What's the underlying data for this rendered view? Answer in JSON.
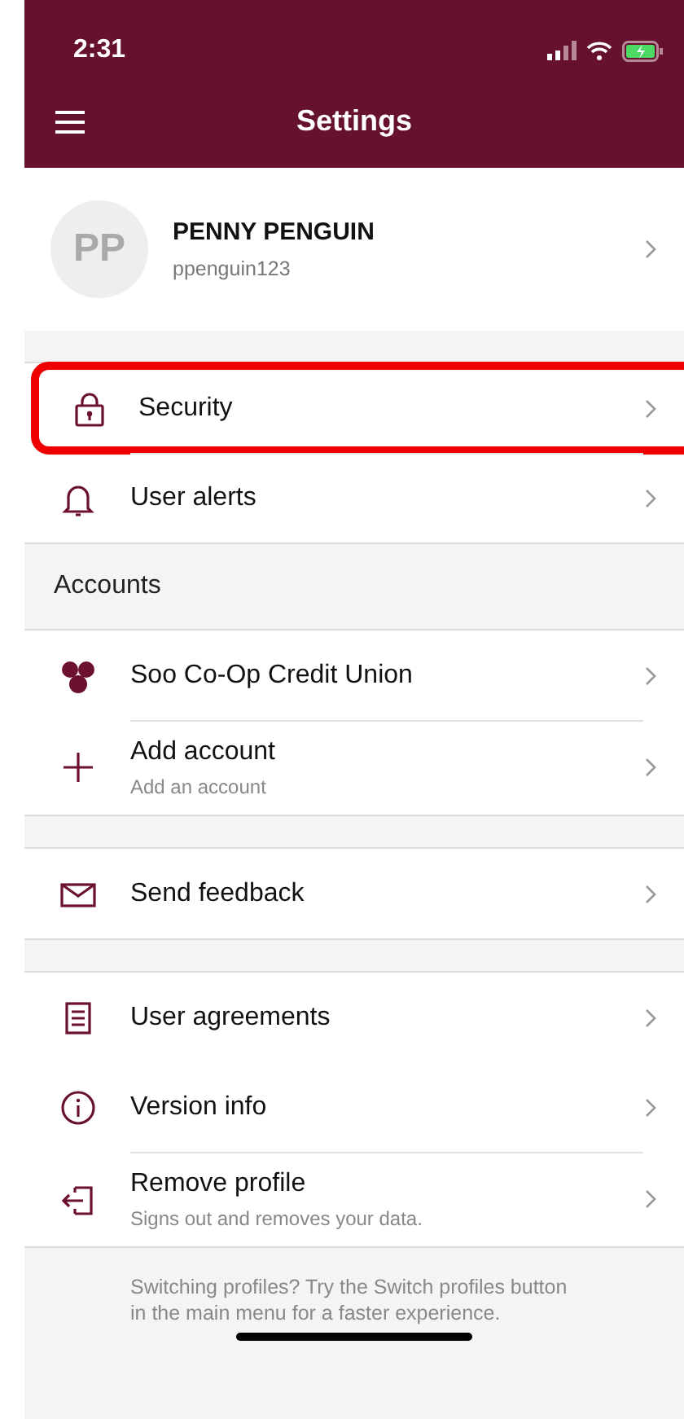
{
  "status_bar": {
    "time": "2:31"
  },
  "header": {
    "title": "Settings"
  },
  "profile": {
    "initials": "PP",
    "name": "PENNY PENGUIN",
    "username": "ppenguin123"
  },
  "groups": [
    {
      "items": [
        {
          "label": "Security",
          "highlighted": true
        },
        {
          "label": "User alerts",
          "highlighted": false
        }
      ]
    },
    {
      "title": "Accounts",
      "items": [
        {
          "label": "Soo Co-Op Credit Union",
          "highlighted": false
        },
        {
          "label": "Add account",
          "subtitle": "Add an account",
          "highlighted": false
        }
      ]
    },
    {
      "items": [
        {
          "label": "Send feedback",
          "highlighted": false
        }
      ]
    },
    {
      "items": [
        {
          "label": "User agreements",
          "highlighted": false
        },
        {
          "label": "Version info",
          "highlighted": false
        },
        {
          "label": "Remove profile",
          "subtitle": "Signs out and removes your data.",
          "highlighted": false
        }
      ]
    }
  ],
  "footer_note": "Switching profiles? Try the Switch profiles button in the main menu for a faster experience."
}
